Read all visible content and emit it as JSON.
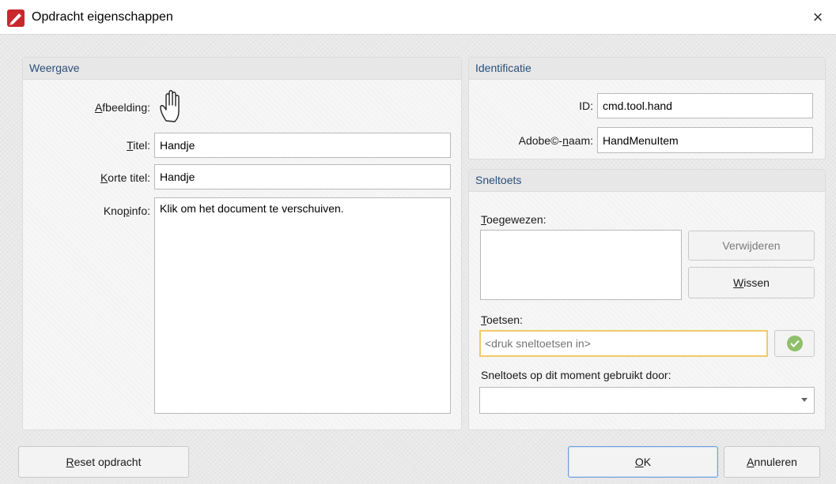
{
  "window": {
    "title": "Opdracht eigenschappen",
    "close_glyph": "×"
  },
  "weergave": {
    "header": "Weergave",
    "afbeelding_label": "Afbeelding:",
    "image_icon": "hand-icon",
    "titel_label": "Titel:",
    "titel_value": "Handje",
    "korte_titel_label": "Korte titel:",
    "korte_titel_value": "Handje",
    "knopinfo_label": "Knopinfo:",
    "knopinfo_value": "Klik om het document te verschuiven."
  },
  "identificatie": {
    "header": "Identificatie",
    "id_label": "ID:",
    "id_value": "cmd.tool.hand",
    "adobe_label": "Adobe©-naam:",
    "adobe_value": "HandMenuItem"
  },
  "sneltoets": {
    "header": "Sneltoets",
    "toegewezen_label": "Toegewezen:",
    "verwijderen_label": "Verwijderen",
    "wissen_label": "Wissen",
    "toetsen_label": "Toetsen:",
    "toetsen_placeholder": "<druk sneltoetsen in>",
    "gebruikt_label": "Sneltoets op dit moment gebruikt door:",
    "gebruikt_value": ""
  },
  "footer": {
    "reset_label": "Reset opdracht",
    "ok_label": "OK",
    "cancel_label": "Annuleren"
  },
  "colors": {
    "accent": "#2a4f7a",
    "focus_border": "#f0c96a",
    "confirm_green": "#8fbf6b",
    "app_icon_red": "#c8282d"
  }
}
